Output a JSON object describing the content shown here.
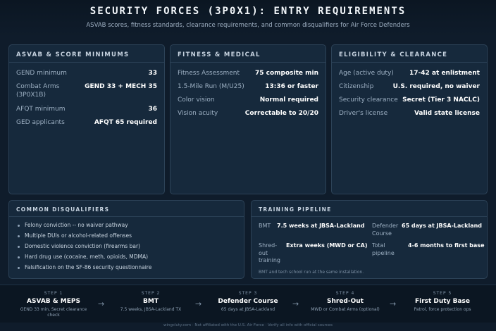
{
  "header": {
    "title": "SECURITY FORCES (3P0X1): ENTRY REQUIREMENTS",
    "subtitle": "ASVAB scores, fitness standards, clearance requirements, and common disqualifiers for Air Force Defenders"
  },
  "asvab": {
    "title": "ASVAB & SCORE MINIMUMS",
    "rows": [
      {
        "label": "GEND minimum",
        "value": "33"
      },
      {
        "label": "Combat Arms (3P0X1B)",
        "label_line1": "Combat Arms",
        "label_line2": "(3P0X1B)",
        "value": "GEND 33 + MECH 35"
      },
      {
        "label": "AFQT minimum",
        "value": "36"
      },
      {
        "label": "GED applicants",
        "value": "AFQT 65 required"
      }
    ]
  },
  "fitness": {
    "title": "FITNESS & MEDICAL",
    "rows": [
      {
        "label": "Fitness Assessment",
        "value": "75 composite min"
      },
      {
        "label": "1.5-Mile Run (M/U25)",
        "value": "13:36 or faster"
      },
      {
        "label": "Color vision",
        "value": "Normal required"
      },
      {
        "label": "Vision acuity",
        "value": "Correctable to 20/20"
      }
    ]
  },
  "eligibility": {
    "title": "ELIGIBILITY & CLEARANCE",
    "rows": [
      {
        "label": "Age (active duty)",
        "value": "17-42 at enlistment"
      },
      {
        "label": "Citizenship",
        "value": "U.S. required, no waiver"
      },
      {
        "label": "Security clearance",
        "value": "Secret (Tier 3 NACLC)"
      },
      {
        "label": "Driver's license",
        "value": "Valid state license"
      }
    ]
  },
  "disqualifiers": {
    "title": "COMMON DISQUALIFIERS",
    "items": [
      "Felony conviction -- no waiver pathway",
      "Multiple DUIs or alcohol-related offenses",
      "Domestic violence conviction (firearms bar)",
      "Hard drug use (cocaine, meth, opioids, MDMA)",
      "Falsification on the SF-86 security questionnaire"
    ]
  },
  "pipeline": {
    "title": "TRAINING PIPELINE",
    "bmt": {
      "label": "BMT",
      "value": "7.5 weeks at JBSA-Lackland"
    },
    "defender": {
      "label": "Defender Course",
      "label_line1": "Defender",
      "label_line2": "Course",
      "value": "65 days at JBSA-Lackland"
    },
    "shredout": {
      "label": "Shred-out training",
      "label_line1": "Shred-",
      "label_line2": "out",
      "label_line3": "training",
      "value": "Extra weeks (MWD or CA)"
    },
    "total": {
      "label": "Total pipeline",
      "label_line1": "Total",
      "label_line2": "pipeline",
      "value": "4-6 months to first base"
    },
    "note": "BMT and tech school run at the same installation."
  },
  "steps": [
    {
      "num": "STEP 1",
      "title": "ASVAB & MEPS",
      "desc_line1": "GEND 33 min, Secret clearance",
      "desc_line2": "check"
    },
    {
      "num": "STEP 2",
      "title": "BMT",
      "desc_line1": "7.5 weeks, JBSA-Lackland TX",
      "desc_line2": ""
    },
    {
      "num": "STEP 3",
      "title": "Defender Course",
      "desc_line1": "65 days at JBSA-Lackland",
      "desc_line2": ""
    },
    {
      "num": "STEP 4",
      "title": "Shred-Out",
      "desc_line1": "MWD or Combat Arms (optional)",
      "desc_line2": ""
    },
    {
      "num": "STEP 5",
      "title": "First Duty Base",
      "desc_line1": "Patrol, force protection ops",
      "desc_line2": ""
    }
  ],
  "arrow_glyph": "→",
  "footer": "wingcluty.com · Not affiliated with the U.S. Air Force · Verify all info with official sources",
  "colors": {
    "background": "#0f1c2b",
    "card": "#16293c",
    "border": "#2c4257",
    "accent_text": "#ffffff"
  }
}
